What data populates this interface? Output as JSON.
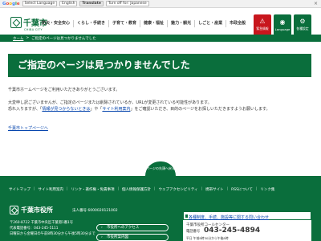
{
  "translate_bar": {
    "brand": [
      "G",
      "o",
      "o",
      "g",
      "l",
      "e"
    ],
    "language_select": "Select Language",
    "english": "English",
    "translate": "Translate",
    "turn_off": "Turn off for: Japanese",
    "close": "×"
  },
  "header": {
    "logo_text": "千葉市",
    "logo_sub": "CHIBA CITY",
    "nav": [
      "防災・安全安心",
      "くらし・手続き",
      "子育て・教育",
      "健康・福祉",
      "魅力・観光",
      "しごと・産業",
      "市政全般"
    ],
    "quick": [
      {
        "label": "緊急情報",
        "symbol": "⚠",
        "color": "red"
      },
      {
        "label": "Language",
        "symbol": "◉",
        "color": "green"
      },
      {
        "label": "各種設定",
        "symbol": "⚙",
        "color": "green"
      }
    ]
  },
  "breadcrumb": {
    "home": "ホーム",
    "sep": ">",
    "current": "ご指定のページは見つかりませんでした"
  },
  "page_title": "ご指定のページは見つかりませんでした",
  "content": {
    "line1": "千葉市ホームページをご利用いただきありがとうございます。",
    "line2": "大変申し訳ございませんが、ご指定のページまたは削除されているか、URLが変更されている可能性があります。",
    "line3_pre": "恐れ入りますが、「",
    "line3_link1": "情報が見つからないときは",
    "line3_mid": "」や「",
    "line3_link2": "サイト利用案内",
    "line3_post": "」をご確認いただき、目的のページをお探しいただきますようお願いします。",
    "top_link": "千葉市トップページへ"
  },
  "page_top": "ページの先頭へ戻る",
  "footer_nav": [
    "サイトマップ",
    "サイト利用案内",
    "リンク・著作権・免責事項",
    "個人情報保護方針",
    "ウェブアクセシビリティ",
    "携帯サイト",
    "RSSについて",
    "リンク集"
  ],
  "footer": {
    "name": "千葉市役所",
    "corp_no": "法人番号 6000020121002",
    "address": "〒260-8722 千葉市中央区千葉港1番1号",
    "phone": "代表電話番号：043-245-5111",
    "hours": "日曜日から金曜日の午前8時30分から午後5時30分まで",
    "btn_access": "市役所へのアクセス",
    "btn_guide": "市役所案内図",
    "call_link": "各種制度、手続、施設等に関する問い合わせ",
    "call_center": "千葉市役所コールセンター",
    "call_tel_label": "電話番号",
    "call_tel": "043-245-4894",
    "call_hours": "平日 午前8時30分から午後8時"
  },
  "colors": {
    "brand_green": "#0a6e3c",
    "alert_red": "#c8161d",
    "link": "#0645ad"
  }
}
